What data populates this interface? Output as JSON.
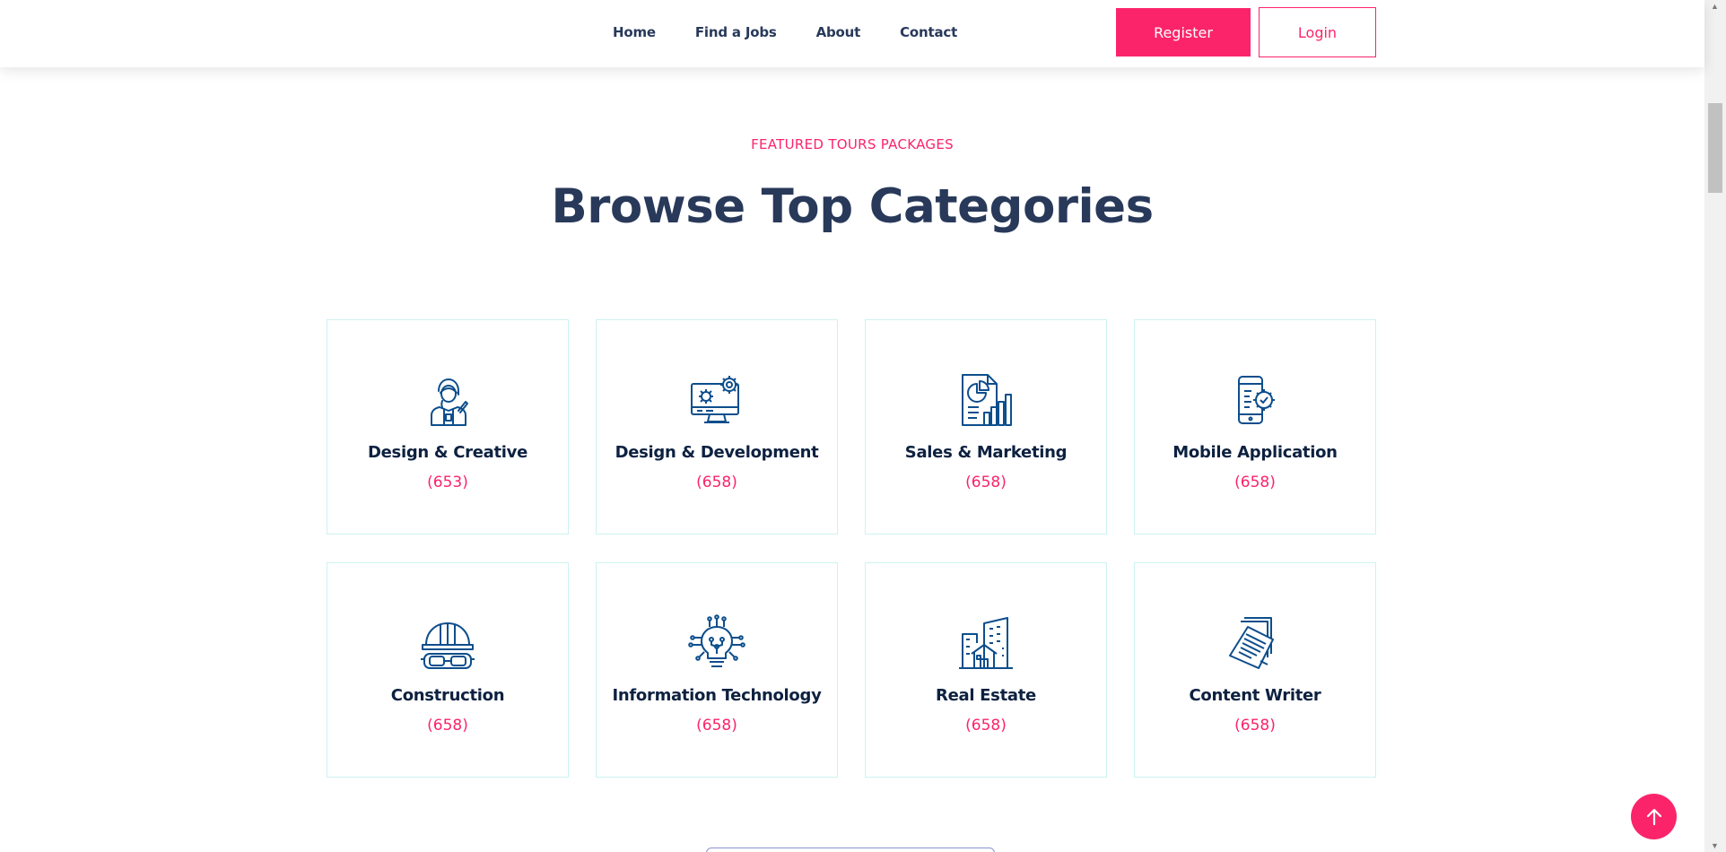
{
  "nav": {
    "items": [
      "Home",
      "Find a Jobs",
      "About",
      "Contact"
    ]
  },
  "header": {
    "register_label": "Register",
    "login_label": "Login"
  },
  "section": {
    "eyebrow": "FEATURED TOURS PACKAGES",
    "title": "Browse Top Categories"
  },
  "categories": [
    {
      "name": "Design & Creative",
      "count": "(653)",
      "icon": "designer-person-icon"
    },
    {
      "name": "Design & Development",
      "count": "(658)",
      "icon": "monitor-gears-icon"
    },
    {
      "name": "Sales & Marketing",
      "count": "(658)",
      "icon": "report-chart-icon"
    },
    {
      "name": "Mobile Application",
      "count": "(658)",
      "icon": "phone-gear-icon"
    },
    {
      "name": "Construction",
      "count": "(658)",
      "icon": "hardhat-goggles-icon"
    },
    {
      "name": "Information Technology",
      "count": "(658)",
      "icon": "circuit-bulb-icon"
    },
    {
      "name": "Real Estate",
      "count": "(658)",
      "icon": "buildings-icon"
    },
    {
      "name": "Content Writer",
      "count": "(658)",
      "icon": "documents-icon"
    }
  ],
  "colors": {
    "accent": "#fb246a",
    "heading": "#28395a",
    "icon": "#0d4e8c",
    "card_border": "#ccf3f1"
  }
}
